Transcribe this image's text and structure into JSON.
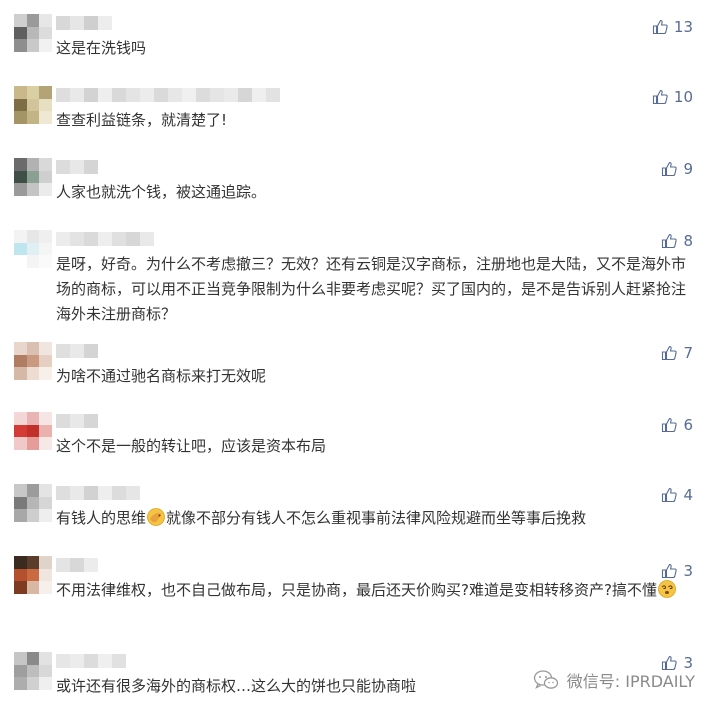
{
  "comments": [
    {
      "text": "这是在洗钱吗",
      "likes": "13"
    },
    {
      "text": "查查利益链条，就清楚了!",
      "likes": "10"
    },
    {
      "text": "人家也就洗个钱，被这通追踪。",
      "likes": "9"
    },
    {
      "text": "是呀，好奇。为什么不考虑撤三？无效？还有云铜是汉字商标，注册地也是大陆，又不是海外市场的商标，可以用不正当竞争限制为什么非要考虑买呢？买了国内的，是不是告诉别人赶紧抢注海外未注册商标？",
      "likes": "8"
    },
    {
      "text": "为啥不通过驰名商标来打无效呢",
      "likes": "7"
    },
    {
      "text": "这个不是一般的转让吧，应该是资本布局",
      "likes": "6"
    },
    {
      "text_a": "有钱人的思维",
      "text_b": "就像不部分有钱人不怎么重视事前法律风险规避而坐等事后挽救",
      "emoji_icon": "facepalm-emoji",
      "likes": "4"
    },
    {
      "text": "不用法律维权，也不自己做布局，只是协商，最后还天价购买?难道是变相转移资产?搞不懂",
      "emoji_icon": "dizzy-face-emoji",
      "likes": "3"
    },
    {
      "text": "或许还有很多海外的商标权…这么大的饼也只能协商啦",
      "likes": "3"
    }
  ],
  "watermark": {
    "text": "微信号: IPRDAILY",
    "icon": "wechat-icon"
  },
  "colors": {
    "like": "#576b95",
    "text": "#333333",
    "watermark": "#8a8a8a"
  }
}
